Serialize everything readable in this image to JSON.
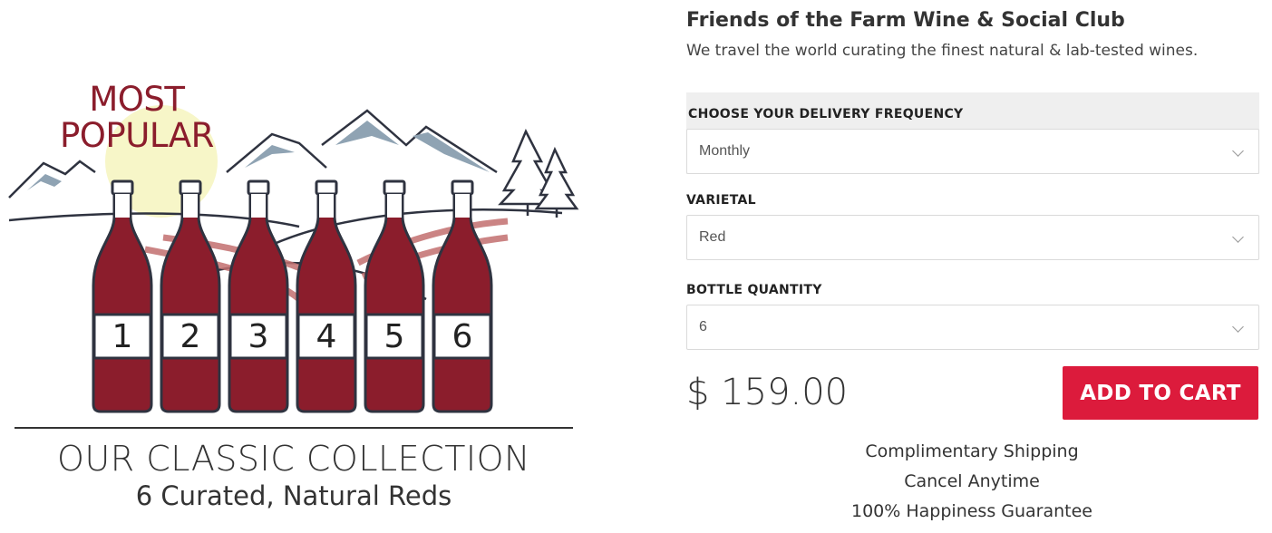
{
  "illustration": {
    "badge_line1": "MOST",
    "badge_line2": "POPULAR",
    "bottle_numbers": [
      "1",
      "2",
      "3",
      "4",
      "5",
      "6"
    ],
    "collection_title": "OUR CLASSIC COLLECTION",
    "collection_subtitle": "6 Curated, Natural Reds",
    "colors": {
      "wine": "#8b1d2c",
      "mountain": "#8fa3b3",
      "sun": "#f7f6c8",
      "outline": "#2f3340",
      "vineyard": "#c26f6f"
    }
  },
  "product": {
    "title": "Friends of the Farm Wine & Social Club",
    "description": "We travel the world curating the finest natural & lab-tested wines.",
    "fields": [
      {
        "label": "CHOOSE YOUR DELIVERY FREQUENCY",
        "value": "Monthly"
      },
      {
        "label": "VARIETAL",
        "value": "Red"
      },
      {
        "label": "BOTTLE QUANTITY",
        "value": "6"
      }
    ],
    "price": "$ 159.00",
    "add_to_cart_label": "ADD TO CART",
    "perks": [
      "Complimentary Shipping",
      "Cancel Anytime",
      "100% Happiness Guarantee"
    ],
    "accent_color": "#dc1b3c"
  }
}
